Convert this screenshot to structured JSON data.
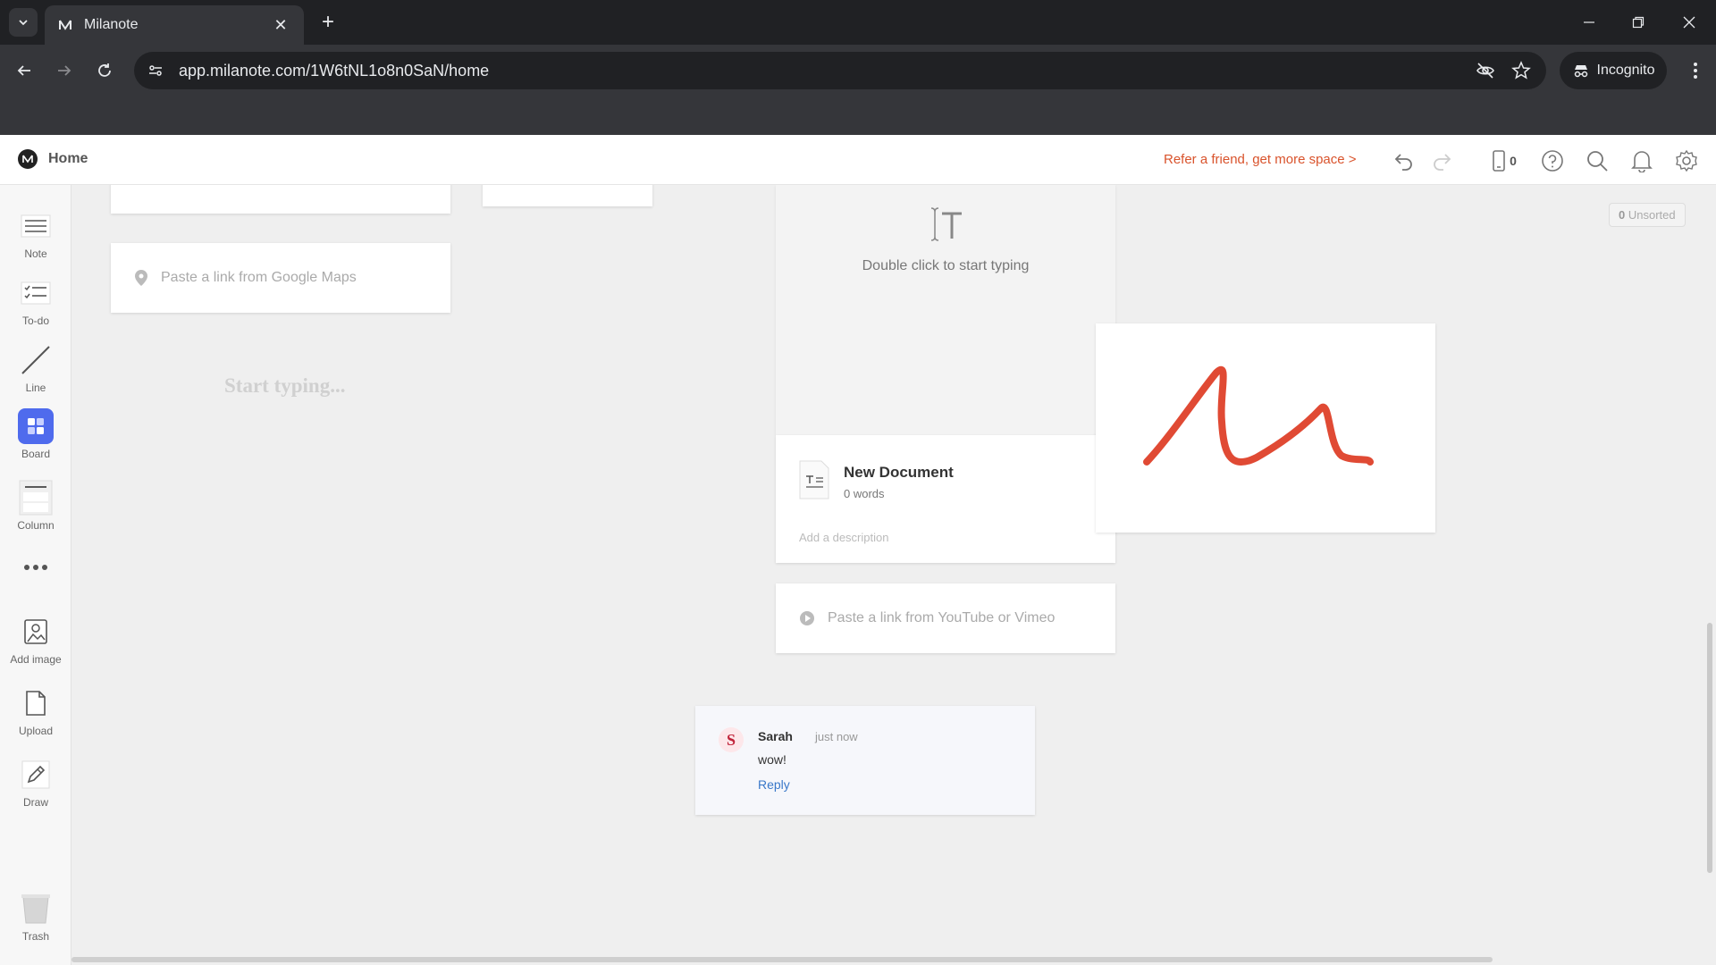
{
  "browser": {
    "tab_title": "Milanote",
    "url": "app.milanote.com/1W6tNL1o8n0SaN/home",
    "incognito_label": "Incognito"
  },
  "header": {
    "home_label": "Home",
    "refer_text": "Refer a friend, get more space >",
    "device_count": "0"
  },
  "sidebar": {
    "tools": [
      {
        "label": "Note"
      },
      {
        "label": "To-do"
      },
      {
        "label": "Line"
      },
      {
        "label": "Board"
      },
      {
        "label": "Column"
      },
      {
        "label": "Add image"
      },
      {
        "label": "Upload"
      },
      {
        "label": "Draw"
      },
      {
        "label": "Trash"
      }
    ]
  },
  "canvas": {
    "maps_placeholder": "Paste a link from Google Maps",
    "start_typing": "Start typing...",
    "unsorted_count": "0",
    "unsorted_label": "Unsorted",
    "doc_hint": "Double click to start typing",
    "doc_title": "New Document",
    "doc_words": "0 words",
    "doc_description_placeholder": "Add a description",
    "video_placeholder": "Paste a link from YouTube or Vimeo",
    "comment": {
      "author": "Sarah",
      "time": "just now",
      "text": "wow!",
      "reply_label": "Reply"
    }
  },
  "colors": {
    "accent_orange": "#d9532c",
    "board_blue": "#4f6bed",
    "sketch_red": "#e04a34",
    "reply_blue": "#3a78c9"
  }
}
